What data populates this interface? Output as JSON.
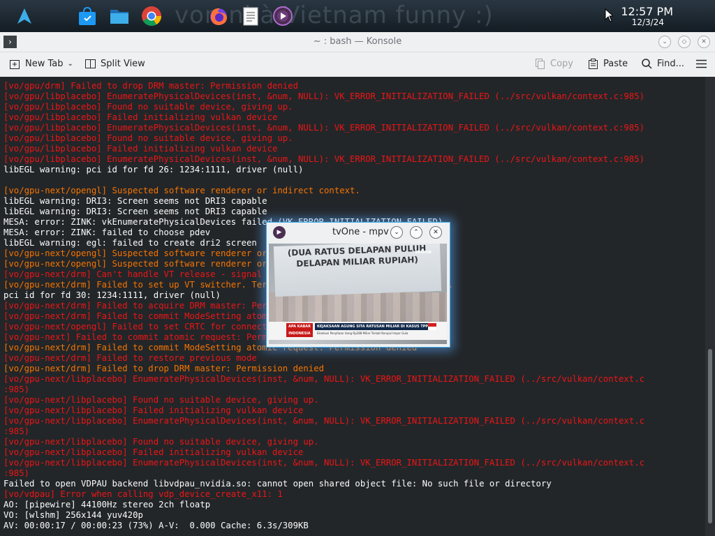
{
  "panel": {
    "launchers": [
      {
        "icon": "app-launcher-icon"
      },
      {
        "icon": "discover-store-icon"
      },
      {
        "icon": "file-manager-icon"
      },
      {
        "icon": "chrome-browser-icon"
      },
      {
        "icon": "firefox-browser-icon"
      },
      {
        "icon": "text-editor-icon"
      },
      {
        "icon": "mpv-player-icon"
      }
    ],
    "background_text": "von nhà Vietnam funny :)",
    "clock": {
      "time": "12:57 PM",
      "date": "12/3/24"
    }
  },
  "konsole": {
    "title": "~ : bash — Konsole",
    "toolbar": {
      "new_tab": "New Tab",
      "split_view": "Split View",
      "copy": "Copy",
      "paste": "Paste",
      "find": "Find..."
    },
    "lines": [
      {
        "c": "r",
        "t": "[vo/gpu/drm] Failed to drop DRM master: Permission denied"
      },
      {
        "c": "r",
        "t": "[vo/gpu/libplacebo] EnumeratePhysicalDevices(inst, &num, NULL): VK_ERROR_INITIALIZATION_FAILED (../src/vulkan/context.c:985)"
      },
      {
        "c": "r",
        "t": "[vo/gpu/libplacebo] Found no suitable device, giving up."
      },
      {
        "c": "r",
        "t": "[vo/gpu/libplacebo] Failed initializing vulkan device"
      },
      {
        "c": "r",
        "t": "[vo/gpu/libplacebo] EnumeratePhysicalDevices(inst, &num, NULL): VK_ERROR_INITIALIZATION_FAILED (../src/vulkan/context.c:985)"
      },
      {
        "c": "r",
        "t": "[vo/gpu/libplacebo] Found no suitable device, giving up."
      },
      {
        "c": "r",
        "t": "[vo/gpu/libplacebo] Failed initializing vulkan device"
      },
      {
        "c": "r",
        "t": "[vo/gpu/libplacebo] EnumeratePhysicalDevices(inst, &num, NULL): VK_ERROR_INITIALIZATION_FAILED (../src/vulkan/context.c:985)"
      },
      {
        "c": "w",
        "t": "libEGL warning: pci id for fd 26: 1234:1111, driver (null)"
      },
      {
        "c": "w",
        "t": ""
      },
      {
        "c": "o",
        "t": "[vo/gpu-next/opengl] Suspected software renderer or indirect context."
      },
      {
        "c": "w",
        "t": "libEGL warning: DRI3: Screen seems not DRI3 capable"
      },
      {
        "c": "w",
        "t": "libEGL warning: DRI3: Screen seems not DRI3 capable"
      },
      {
        "c": "w",
        "t": "MESA: error: ZINK: vkEnumeratePhysicalDevices failed (VK_ERROR_INITIALIZATION_FAILED)"
      },
      {
        "c": "w",
        "t": "MESA: error: ZINK: failed to choose pdev"
      },
      {
        "c": "w",
        "t": "libEGL warning: egl: failed to create dri2 screen"
      },
      {
        "c": "o",
        "t": "[vo/gpu-next/opengl] Suspected software renderer or indirect context."
      },
      {
        "c": "o",
        "t": "[vo/gpu-next/opengl] Suspected software renderer or indirect context."
      },
      {
        "c": "r",
        "t": "[vo/gpu-next/drm] Can't handle VT release - signal already used"
      },
      {
        "c": "o",
        "t": "[vo/gpu-next/drm] Failed to set up VT switcher. Terminal switching will be unavailable."
      },
      {
        "c": "w",
        "t": "pci id for fd 30: 1234:1111, driver (null)"
      },
      {
        "c": "r",
        "t": "[vo/gpu-next/drm] Failed to acquire DRM master: Permission denied"
      },
      {
        "c": "r",
        "t": "[vo/gpu-next/drm] Failed to commit ModeSetting atomic request (-13)"
      },
      {
        "c": "r",
        "t": "[vo/gpu-next/opengl] Failed to set CRTC for connector"
      },
      {
        "c": "r",
        "t": "[vo/gpu-next] Failed to commit atomic request: Permission denied"
      },
      {
        "c": "o",
        "t": "[vo/gpu-next/drm] Failed to commit ModeSetting atomic request: Permission denied"
      },
      {
        "c": "r",
        "t": "[vo/gpu-next/drm] Failed to restore previous mode"
      },
      {
        "c": "o",
        "t": "[vo/gpu-next/drm] Failed to drop DRM master: Permission denied"
      },
      {
        "c": "r",
        "t": "[vo/gpu-next/libplacebo] EnumeratePhysicalDevices(inst, &num, NULL): VK_ERROR_INITIALIZATION_FAILED (../src/vulkan/context.c"
      },
      {
        "c": "r",
        "t": ":985)"
      },
      {
        "c": "r",
        "t": "[vo/gpu-next/libplacebo] Found no suitable device, giving up."
      },
      {
        "c": "r",
        "t": "[vo/gpu-next/libplacebo] Failed initializing vulkan device"
      },
      {
        "c": "r",
        "t": "[vo/gpu-next/libplacebo] EnumeratePhysicalDevices(inst, &num, NULL): VK_ERROR_INITIALIZATION_FAILED (../src/vulkan/context.c"
      },
      {
        "c": "r",
        "t": ":985)"
      },
      {
        "c": "r",
        "t": "[vo/gpu-next/libplacebo] Found no suitable device, giving up."
      },
      {
        "c": "r",
        "t": "[vo/gpu-next/libplacebo] Failed initializing vulkan device"
      },
      {
        "c": "r",
        "t": "[vo/gpu-next/libplacebo] EnumeratePhysicalDevices(inst, &num, NULL): VK_ERROR_INITIALIZATION_FAILED (../src/vulkan/context.c"
      },
      {
        "c": "r",
        "t": ":985)"
      },
      {
        "c": "w",
        "t": "Failed to open VDPAU backend libvdpau_nvidia.so: cannot open shared object file: No such file or directory"
      },
      {
        "c": "r",
        "t": "[vo/vdpau] Error when calling vdp_device_create_x11: 1"
      },
      {
        "c": "w",
        "t": "AO: [pipewire] 44100Hz stereo 2ch floatp"
      },
      {
        "c": "w",
        "t": "VO: [wlshm] 256x144 yuv420p"
      },
      {
        "c": "w",
        "t": "AV: 00:00:17 / 00:00:23 (73%) A-V:  0.000 Cache: 6.3s/309KB"
      }
    ]
  },
  "mpv": {
    "title": "tvOne - mpv",
    "video": {
      "sign_text": "(DUA RATUS DELAPAN PULUH DELAPAN MILIAR RUPIAH)",
      "ticker_brand": "APA KABAR INDONESIA",
      "ticker_headline": "KEJAKSAAN AGUNG SITA RATUSAN MILIAR DI KASUS TPPU",
      "ticker_sub": "Eksekusi Penyitaan Uang Rp288 Miliar Terkait Korupsi Impor Gula",
      "channel_logo": "tvOne"
    }
  }
}
